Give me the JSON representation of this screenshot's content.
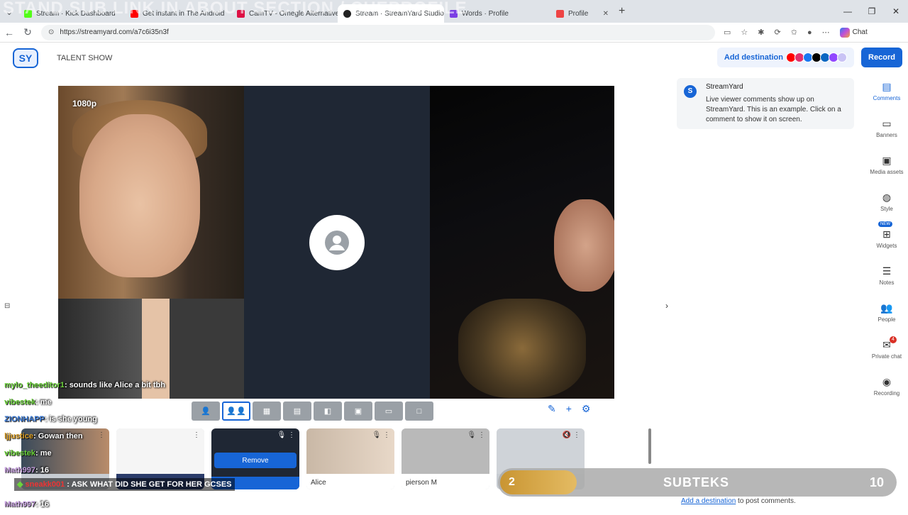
{
  "overlay": {
    "title": "STAND SUB LINK IN ABOUT SECTION / CHEPROFILE"
  },
  "browser": {
    "tabs": [
      {
        "label": "Stream · Kick Dashboard",
        "color": "#53fc18"
      },
      {
        "label": "Get instant in The Android",
        "color": "#ff0000"
      },
      {
        "label": "CamTV - Omegle Alternative",
        "color": "#d14"
      },
      {
        "label": "Stream · StreamYard Studio",
        "color": "#222"
      },
      {
        "label": "Words · Profile",
        "color": "#7b3fe4"
      },
      {
        "label": "Profile",
        "color": "#e44"
      }
    ],
    "url": "https://streamyard.com/a7c6i35n3f",
    "copilot_label": "Chat"
  },
  "app": {
    "show_name": "TALENT SHOW",
    "add_destination": "Add destination",
    "record": "Record",
    "dest_colors": [
      "#ff0000",
      "#e1306c",
      "#1877f2",
      "#000000",
      "#0a66c2",
      "#9146ff",
      "#c9c3f5"
    ]
  },
  "stage": {
    "quality": "1080p"
  },
  "thumbs": {
    "remove": "Remove",
    "names": [
      "",
      "",
      "",
      "Alice",
      "pierson M",
      ""
    ]
  },
  "chat_overlay": [
    {
      "user": "mylo_theeditor1",
      "msg": ": sounds like Alice a bit tbh"
    },
    {
      "user": "vibestek",
      "msg": ": me"
    },
    {
      "user": "ZIONHAPP",
      "msg": ": is she young"
    },
    {
      "user": "ljjustice",
      "msg": ": Gowan then"
    },
    {
      "user": "vibestek",
      "msg": ": me"
    },
    {
      "user": "Math997",
      "msg": ": 16"
    },
    {
      "user": "",
      "msg": ""
    },
    {
      "user": "Math997",
      "msg": ": 16"
    }
  ],
  "banner": {
    "user": "sneakk001",
    "msg": ": ASK WHAT DID SHE GET FOR HER GCSES"
  },
  "sub_widget": {
    "current": "2",
    "label": "SUBTEKS",
    "goal": "10"
  },
  "side_panel": {
    "title": "StreamYard",
    "desc": "Live viewer comments show up on StreamYard. This is an example. Click on a comment to show it on screen.",
    "add_dest_link": "Add a destination",
    "add_dest_suffix": " to post comments."
  },
  "rail": [
    {
      "label": "Comments",
      "icon": "▤"
    },
    {
      "label": "Banners",
      "icon": "▭"
    },
    {
      "label": "Media assets",
      "icon": "▣"
    },
    {
      "label": "Style",
      "icon": "◍"
    },
    {
      "label": "Widgets",
      "icon": "⊞",
      "badge": "NEW"
    },
    {
      "label": "Notes",
      "icon": "☰"
    },
    {
      "label": "People",
      "icon": "👥"
    },
    {
      "label": "Private chat",
      "icon": "✉",
      "count": "4"
    },
    {
      "label": "Recording",
      "icon": "◉"
    }
  ]
}
